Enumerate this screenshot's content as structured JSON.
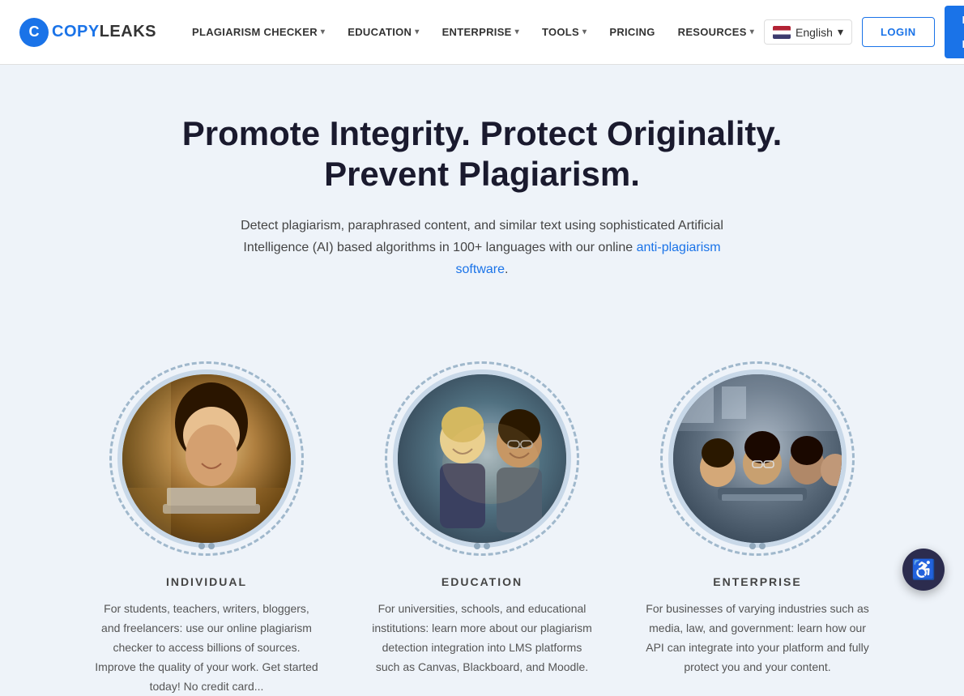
{
  "brand": {
    "logo_letter": "C",
    "logo_name_part1": "COPY",
    "logo_name_part2": "LEAKS"
  },
  "navbar": {
    "items": [
      {
        "label": "PLAGIARISM CHECKER",
        "has_dropdown": true
      },
      {
        "label": "EDUCATION",
        "has_dropdown": true
      },
      {
        "label": "ENTERPRISE",
        "has_dropdown": true
      },
      {
        "label": "TOOLS",
        "has_dropdown": true
      },
      {
        "label": "PRICING",
        "has_dropdown": false
      },
      {
        "label": "RESOURCES",
        "has_dropdown": true
      }
    ],
    "language": "English",
    "login_label": "LOGIN",
    "demo_label": "BOOK A DEMO"
  },
  "hero": {
    "title": "Promote Integrity. Protect Originality. Prevent Plagiarism.",
    "subtitle_text": "Detect plagiarism, paraphrased content, and similar text using sophisticated Artificial Intelligence (AI) based algorithms in 100+ languages with our online ",
    "subtitle_link_text": "anti-plagiarism software",
    "subtitle_end": "."
  },
  "cards": [
    {
      "id": "individual",
      "category": "INDIVIDUAL",
      "description": "For students, teachers, writers, bloggers, and freelancers: use our online plagiarism checker to access billions of sources. Improve the quality of your work. Get started today! No credit card..."
    },
    {
      "id": "education",
      "category": "EDUCATION",
      "description": "For universities, schools, and educational institutions: learn more about our plagiarism detection integration into LMS platforms such as Canvas, Blackboard, and Moodle."
    },
    {
      "id": "enterprise",
      "category": "ENTERPRISE",
      "description": "For businesses of varying industries such as media, law, and government: learn how our API can integrate into your platform and fully protect you and your content."
    }
  ],
  "accessibility": {
    "icon": "♿",
    "label": "Accessibility"
  }
}
